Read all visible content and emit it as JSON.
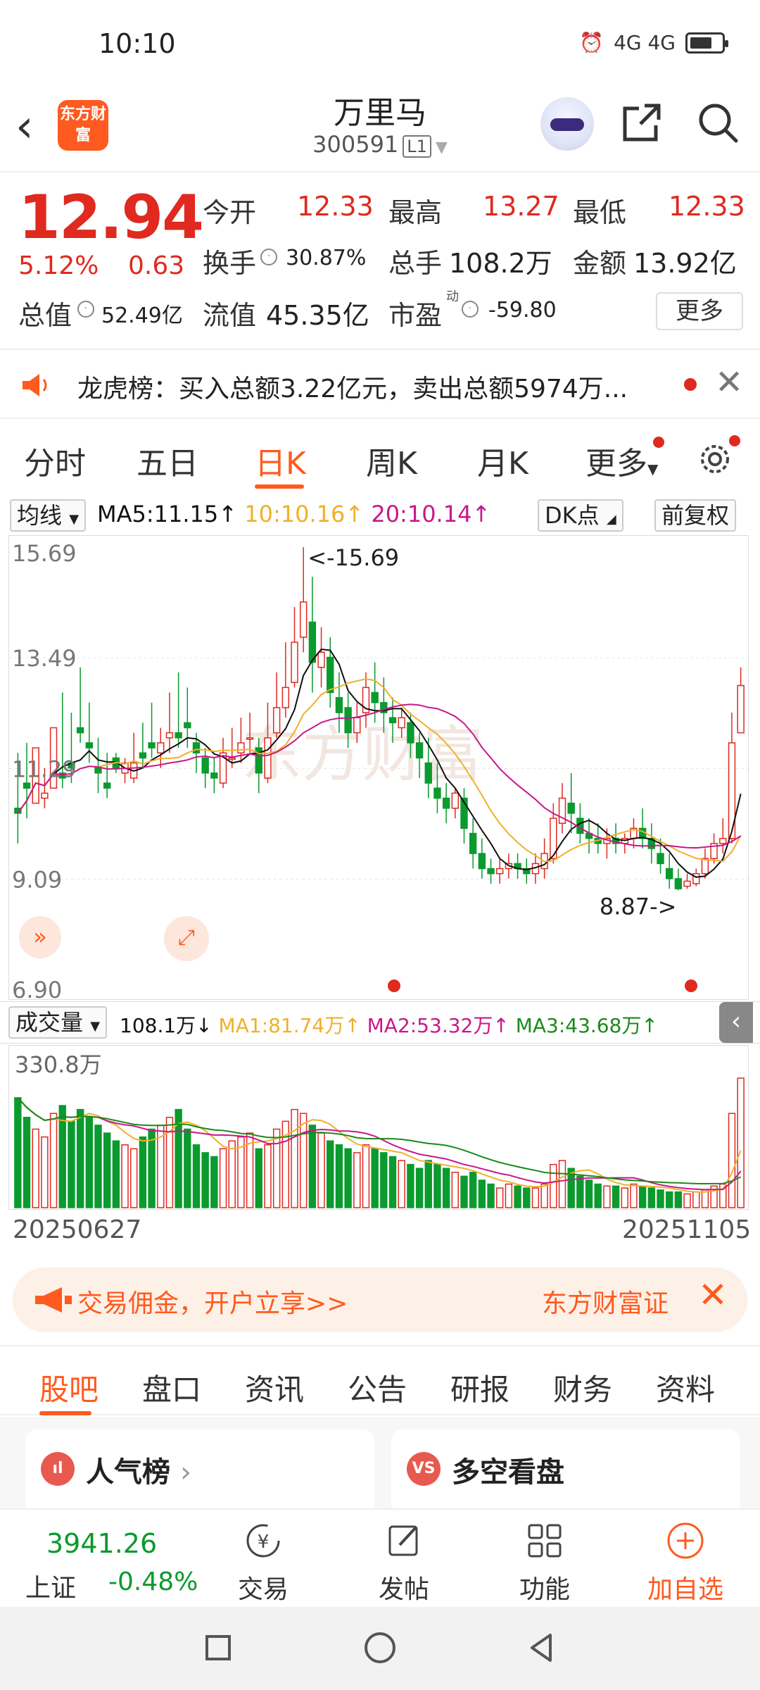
{
  "status": {
    "time": "10:10",
    "signal": "4G 4G"
  },
  "header": {
    "logo_text": "东方财富",
    "stock_name": "万里马",
    "stock_code": "300591",
    "level_badge": "L1"
  },
  "quote": {
    "price": "12.94",
    "change_pct": "5.12%",
    "change_amt": "0.63",
    "open_label": "今开",
    "open": "12.33",
    "high_label": "最高",
    "high": "13.27",
    "low_label": "最低",
    "low": "12.33",
    "turnover_label": "换手",
    "turnover": "30.87%",
    "volume_label": "总手",
    "volume": "108.2万",
    "amount_label": "金额",
    "amount": "13.92亿",
    "mktcap_label": "总值",
    "mktcap": "52.49亿",
    "float_label": "流值",
    "float": "45.35亿",
    "pe_label": "市盈",
    "pe_sup": "动",
    "pe": "-59.80",
    "more_label": "更多"
  },
  "news": {
    "text": "龙虎榜：买入总额3.22亿元，卖出总额5974万..."
  },
  "chart_tabs": [
    "分时",
    "五日",
    "日K",
    "周K",
    "月K",
    "更多"
  ],
  "active_chart_tab": "日K",
  "indicator_row": {
    "ma_button": "均线",
    "ma5": "MA5:11.15↑",
    "ma10": "10:10.16↑",
    "ma20": "20:10.14↑",
    "dk_button": "DK点",
    "adjust_button": "前复权"
  },
  "colors": {
    "up": "#e0291f",
    "down": "#0a9a2e",
    "accent": "#ff5a1f",
    "ma5": "#111111",
    "ma10": "#f0b02a",
    "ma20": "#c8188a",
    "ma_vol3": "#1a8a1a"
  },
  "chart_data": {
    "type": "candlestick",
    "y_ticks": [
      "15.69",
      "13.49",
      "11.29",
      "9.09",
      "6.90"
    ],
    "ylim": [
      6.9,
      15.69
    ],
    "annotations": {
      "high_label": "<-15.69",
      "low_label": "8.87->"
    },
    "candles": [
      [
        10.5,
        11.6,
        10.4,
        9.8
      ],
      [
        11.0,
        11.8,
        10.9,
        10.3
      ],
      [
        10.6,
        10.9,
        11.7,
        11.6
      ],
      [
        10.7,
        11.3,
        10.8,
        10.5
      ],
      [
        10.9,
        11.2,
        12.1,
        11.9
      ],
      [
        11.2,
        12.8,
        11.1,
        10.9
      ],
      [
        11.4,
        12.4,
        11.3,
        11.0
      ],
      [
        12.1,
        13.3,
        12.0,
        11.8
      ],
      [
        11.8,
        12.6,
        11.7,
        11.4
      ],
      [
        11.3,
        11.9,
        11.2,
        10.8
      ],
      [
        11.0,
        11.6,
        10.9,
        10.7
      ],
      [
        11.5,
        11.6,
        11.3,
        11.2
      ],
      [
        11.2,
        11.5,
        11.4,
        11.0
      ],
      [
        11.1,
        12.0,
        11.4,
        11.0
      ],
      [
        11.6,
        12.2,
        11.5,
        11.3
      ],
      [
        11.8,
        12.6,
        11.7,
        11.5
      ],
      [
        11.6,
        12.1,
        11.8,
        11.3
      ],
      [
        11.9,
        12.8,
        12.0,
        11.6
      ],
      [
        12.0,
        13.2,
        11.9,
        11.7
      ],
      [
        12.2,
        12.9,
        12.1,
        11.7
      ],
      [
        11.8,
        12.0,
        11.6,
        11.2
      ],
      [
        11.5,
        11.7,
        11.2,
        10.9
      ],
      [
        11.2,
        11.5,
        11.1,
        10.8
      ],
      [
        11.0,
        11.9,
        11.6,
        10.9
      ],
      [
        11.5,
        12.1,
        11.5,
        11.3
      ],
      [
        11.6,
        12.3,
        11.8,
        11.4
      ],
      [
        11.9,
        12.4,
        11.9,
        11.6
      ],
      [
        11.7,
        11.9,
        11.2,
        10.8
      ],
      [
        11.1,
        12.6,
        11.9,
        11.0
      ],
      [
        12.0,
        13.2,
        12.5,
        11.9
      ],
      [
        12.5,
        13.8,
        12.9,
        12.3
      ],
      [
        13.0,
        14.5,
        13.8,
        12.9
      ],
      [
        13.9,
        15.69,
        14.6,
        13.6
      ],
      [
        14.2,
        15.1,
        13.4,
        12.8
      ],
      [
        13.3,
        14.1,
        13.6,
        12.9
      ],
      [
        13.5,
        13.9,
        12.8,
        12.5
      ],
      [
        12.7,
        13.2,
        12.4,
        12.0
      ],
      [
        12.5,
        12.8,
        12.0,
        11.7
      ],
      [
        12.0,
        12.6,
        12.3,
        11.8
      ],
      [
        12.4,
        13.2,
        12.9,
        12.1
      ],
      [
        12.8,
        13.4,
        12.6,
        12.2
      ],
      [
        12.6,
        13.1,
        12.4,
        12.0
      ],
      [
        12.3,
        12.7,
        12.2,
        11.8
      ],
      [
        12.1,
        12.5,
        12.3,
        11.9
      ],
      [
        12.2,
        12.4,
        11.8,
        11.5
      ],
      [
        11.8,
        12.0,
        11.5,
        11.1
      ],
      [
        11.4,
        11.9,
        11.0,
        10.7
      ],
      [
        10.9,
        11.4,
        10.7,
        10.4
      ],
      [
        10.7,
        11.0,
        10.5,
        10.2
      ],
      [
        10.5,
        10.9,
        10.8,
        10.3
      ],
      [
        10.7,
        10.9,
        10.1,
        9.8
      ],
      [
        10.0,
        10.3,
        9.6,
        9.3
      ],
      [
        9.6,
        9.9,
        9.3,
        9.1
      ],
      [
        9.3,
        9.5,
        9.2,
        9.0
      ],
      [
        9.2,
        9.5,
        9.3,
        9.0
      ],
      [
        9.3,
        9.6,
        9.4,
        9.1
      ],
      [
        9.4,
        9.6,
        9.3,
        9.1
      ],
      [
        9.3,
        9.5,
        9.2,
        9.0
      ],
      [
        9.2,
        9.6,
        9.4,
        9.0
      ],
      [
        9.3,
        9.9,
        9.6,
        9.1
      ],
      [
        9.5,
        10.6,
        10.3,
        9.4
      ],
      [
        10.2,
        11.0,
        10.7,
        10.0
      ],
      [
        10.6,
        11.2,
        10.4,
        10.0
      ],
      [
        10.3,
        10.6,
        10.0,
        9.8
      ],
      [
        10.0,
        10.3,
        9.9,
        9.6
      ],
      [
        9.9,
        10.2,
        9.8,
        9.6
      ],
      [
        9.8,
        10.1,
        9.9,
        9.5
      ],
      [
        9.9,
        10.2,
        9.8,
        9.6
      ],
      [
        9.8,
        10.0,
        9.9,
        9.6
      ],
      [
        9.9,
        10.3,
        10.1,
        9.7
      ],
      [
        10.1,
        10.5,
        9.9,
        9.7
      ],
      [
        9.9,
        10.2,
        9.7,
        9.4
      ],
      [
        9.6,
        9.9,
        9.4,
        9.2
      ],
      [
        9.3,
        9.6,
        9.1,
        8.9
      ],
      [
        9.1,
        9.3,
        8.9,
        8.87
      ],
      [
        8.95,
        9.2,
        9.05,
        8.9
      ],
      [
        9.0,
        9.3,
        9.2,
        8.95
      ],
      [
        9.2,
        9.7,
        9.5,
        9.1
      ],
      [
        9.5,
        10.0,
        9.8,
        9.4
      ],
      [
        9.8,
        10.3,
        9.9,
        9.6
      ],
      [
        9.9,
        12.4,
        11.8,
        9.8
      ],
      [
        12.0,
        13.3,
        12.94,
        12.0
      ]
    ],
    "volume_label": "成交量",
    "volume_value": "108.1万↓",
    "vol_ma1": "MA1:81.74万↑",
    "vol_ma2": "MA2:53.32万↑",
    "vol_ma3": "MA3:43.68万↑",
    "volume_max_label": "330.8万",
    "volumes": [
      280,
      230,
      200,
      180,
      240,
      260,
      220,
      250,
      230,
      210,
      190,
      170,
      160,
      150,
      180,
      200,
      210,
      230,
      250,
      200,
      160,
      140,
      130,
      150,
      170,
      180,
      190,
      150,
      160,
      200,
      220,
      250,
      240,
      210,
      190,
      170,
      160,
      150,
      140,
      160,
      150,
      140,
      130,
      120,
      110,
      100,
      120,
      110,
      100,
      90,
      80,
      90,
      70,
      60,
      50,
      60,
      55,
      50,
      50,
      60,
      110,
      120,
      100,
      80,
      70,
      60,
      55,
      55,
      50,
      60,
      55,
      50,
      45,
      40,
      40,
      35,
      40,
      45,
      55,
      60,
      240,
      330
    ],
    "x_labels": [
      "20250627",
      "20251105"
    ]
  },
  "promo": {
    "text": "交易佣金，开户立享>>",
    "brand": "东方财富证"
  },
  "section_tabs": [
    "股吧",
    "盘口",
    "资讯",
    "公告",
    "研报",
    "财务",
    "资料"
  ],
  "active_section_tab": "股吧",
  "cards": [
    {
      "icon": "ıl",
      "title": "人气榜"
    },
    {
      "icon": "VS",
      "title": "多空看盘"
    }
  ],
  "bottom_bar": {
    "index_value": "3941.26",
    "index_name": "上证",
    "index_change": "-0.48%",
    "items": [
      "交易",
      "发帖",
      "功能",
      "加自选"
    ]
  }
}
